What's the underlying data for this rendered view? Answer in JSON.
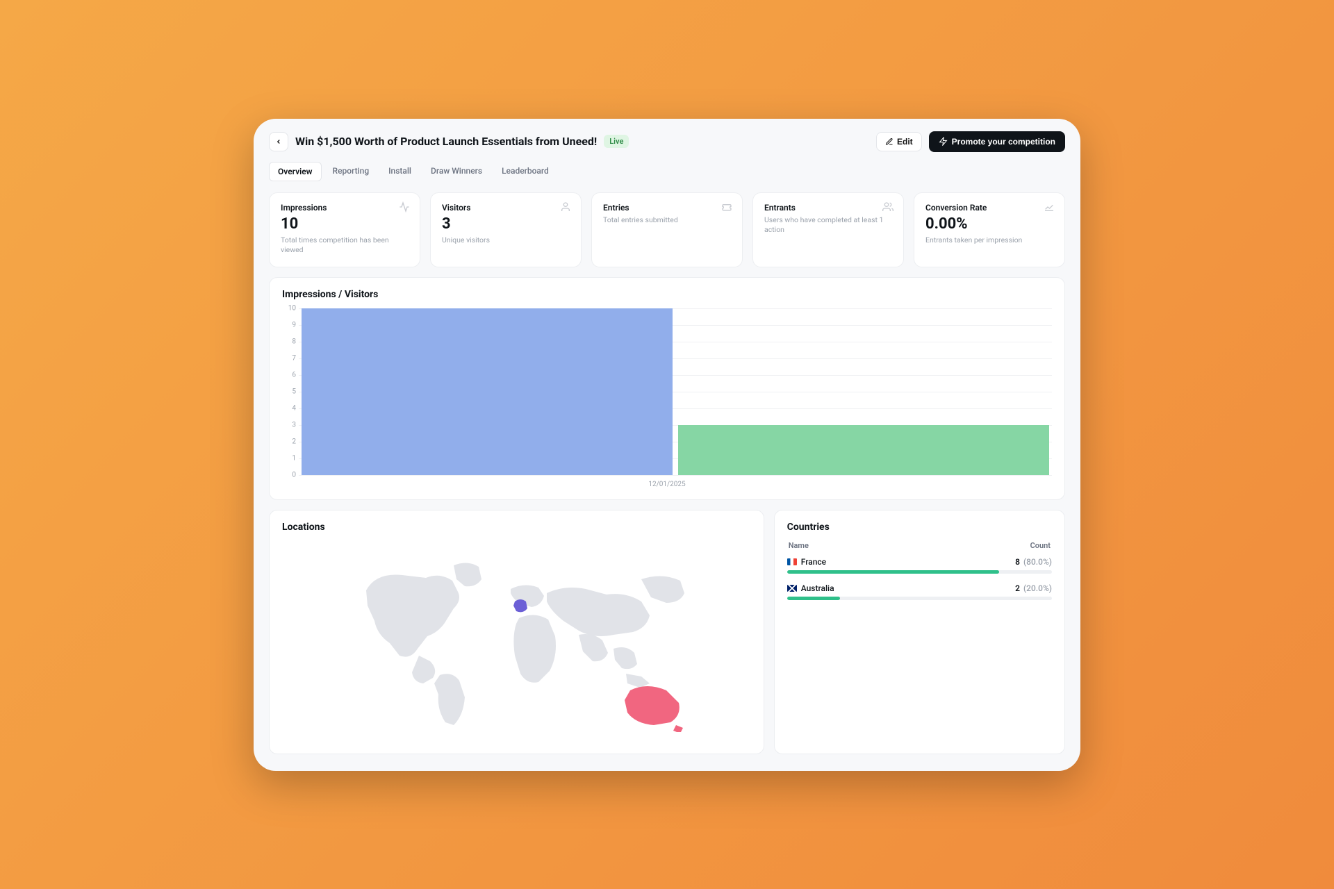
{
  "header": {
    "title": "Win $1,500 Worth of Product Launch Essentials from Uneed!",
    "status_badge": "Live",
    "edit_label": "Edit",
    "promote_label": "Promote your competition"
  },
  "tabs": [
    {
      "label": "Overview",
      "active": true
    },
    {
      "label": "Reporting",
      "active": false
    },
    {
      "label": "Install",
      "active": false
    },
    {
      "label": "Draw Winners",
      "active": false
    },
    {
      "label": "Leaderboard",
      "active": false
    }
  ],
  "stats": {
    "impressions": {
      "title": "Impressions",
      "value": "10",
      "sub": "Total times competition has been viewed"
    },
    "visitors": {
      "title": "Visitors",
      "value": "3",
      "sub": "Unique visitors"
    },
    "entries": {
      "title": "Entries",
      "value": "",
      "sub": "Total entries submitted"
    },
    "entrants": {
      "title": "Entrants",
      "value": "",
      "sub": "Users who have completed at least 1 action"
    },
    "conversion": {
      "title": "Conversion Rate",
      "value": "0.00%",
      "sub": "Entrants taken per impression"
    }
  },
  "chart_panel_title": "Impressions / Visitors",
  "chart_data": {
    "type": "bar",
    "categories": [
      "12/01/2025"
    ],
    "series": [
      {
        "name": "Impressions",
        "values": [
          10
        ],
        "color": "#91aeeb"
      },
      {
        "name": "Visitors",
        "values": [
          3
        ],
        "color": "#86d6a4"
      }
    ],
    "ylim": [
      0,
      10
    ],
    "yticks": [
      0,
      1,
      2,
      3,
      4,
      5,
      6,
      7,
      8,
      9,
      10
    ],
    "xlabel": "12/01/2025"
  },
  "locations_title": "Locations",
  "countries_title": "Countries",
  "countries_table": {
    "headers": {
      "name": "Name",
      "count": "Count"
    },
    "rows": [
      {
        "flag": "fr",
        "name": "France",
        "count": "8",
        "pct": "(80.0%)",
        "width": 80
      },
      {
        "flag": "au",
        "name": "Australia",
        "count": "2",
        "pct": "(20.0%)",
        "width": 20
      }
    ]
  }
}
